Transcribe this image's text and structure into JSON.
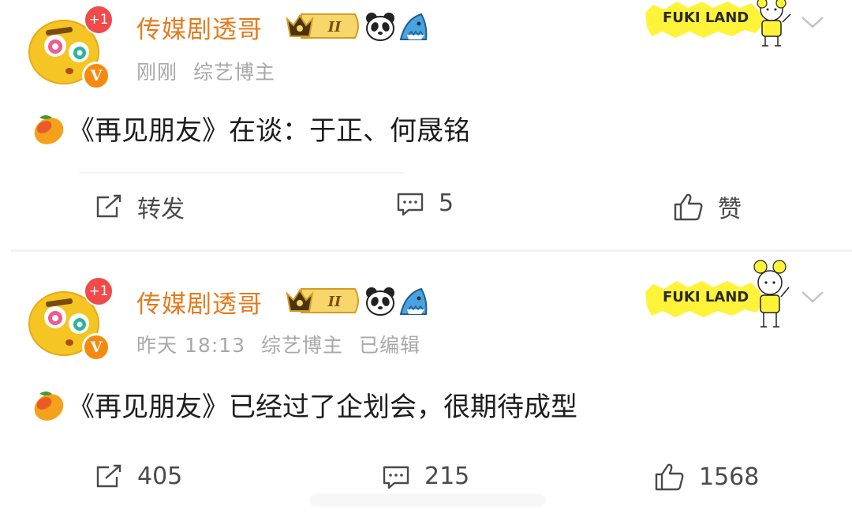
{
  "posts": [
    {
      "username": "传媒剧透哥",
      "plus_badge": "+1",
      "verified_badge": "V",
      "level": "II",
      "time": "刚刚",
      "category": "综艺博主",
      "edited": "",
      "sticker_text": "FUKI LAND",
      "content": "《再见朋友》在谈：于正、何晟铭",
      "repost_label": "转发",
      "comment_count": "5",
      "like_label": "赞"
    },
    {
      "username": "传媒剧透哥",
      "plus_badge": "+1",
      "verified_badge": "V",
      "level": "II",
      "time": "昨天 18:13",
      "category": "综艺博主",
      "edited": "已编辑",
      "sticker_text": "FUKI LAND",
      "content": "《再见朋友》已经过了企划会，很期待成型",
      "repost_label": "405",
      "comment_count": "215",
      "like_label": "1568"
    }
  ],
  "icons": {
    "avatar": "yellow-emoji-avatar",
    "crown": "crown-level-badge-icon",
    "panda": "panda-icon",
    "shark": "shark-icon",
    "mango": "mango-emoji-icon",
    "repost": "repost-icon",
    "comment": "comment-icon",
    "like": "thumbs-up-icon",
    "more": "chevron-down-icon"
  },
  "colors": {
    "username": "#e57a1c",
    "meta": "#a8a8a8",
    "badge_red": "#f14a4a",
    "verified_orange": "#f48a0f",
    "sticker_yellow": "#fff33a"
  }
}
